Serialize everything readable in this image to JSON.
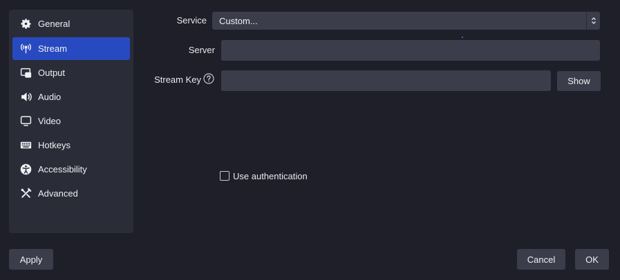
{
  "sidebar": {
    "items": [
      {
        "label": "General",
        "icon": "gear-icon"
      },
      {
        "label": "Stream",
        "icon": "antenna-icon",
        "active": true
      },
      {
        "label": "Output",
        "icon": "output-icon"
      },
      {
        "label": "Audio",
        "icon": "speaker-icon"
      },
      {
        "label": "Video",
        "icon": "monitor-icon"
      },
      {
        "label": "Hotkeys",
        "icon": "keyboard-icon"
      },
      {
        "label": "Accessibility",
        "icon": "accessibility-icon"
      },
      {
        "label": "Advanced",
        "icon": "wrench-screwdriver-icon"
      }
    ]
  },
  "stream": {
    "service_label": "Service",
    "service_value": "Custom...",
    "server_label": "Server",
    "server_value": "",
    "stream_key_label": "Stream Key",
    "stream_key_value": "",
    "show_label": "Show",
    "use_auth_label": "Use authentication",
    "use_auth_checked": false
  },
  "footer": {
    "apply_label": "Apply",
    "cancel_label": "Cancel",
    "ok_label": "OK"
  },
  "colors": {
    "background": "#1e1f29",
    "panel": "#2a2c38",
    "control": "#3b3d4b",
    "accent": "#284ac0"
  }
}
